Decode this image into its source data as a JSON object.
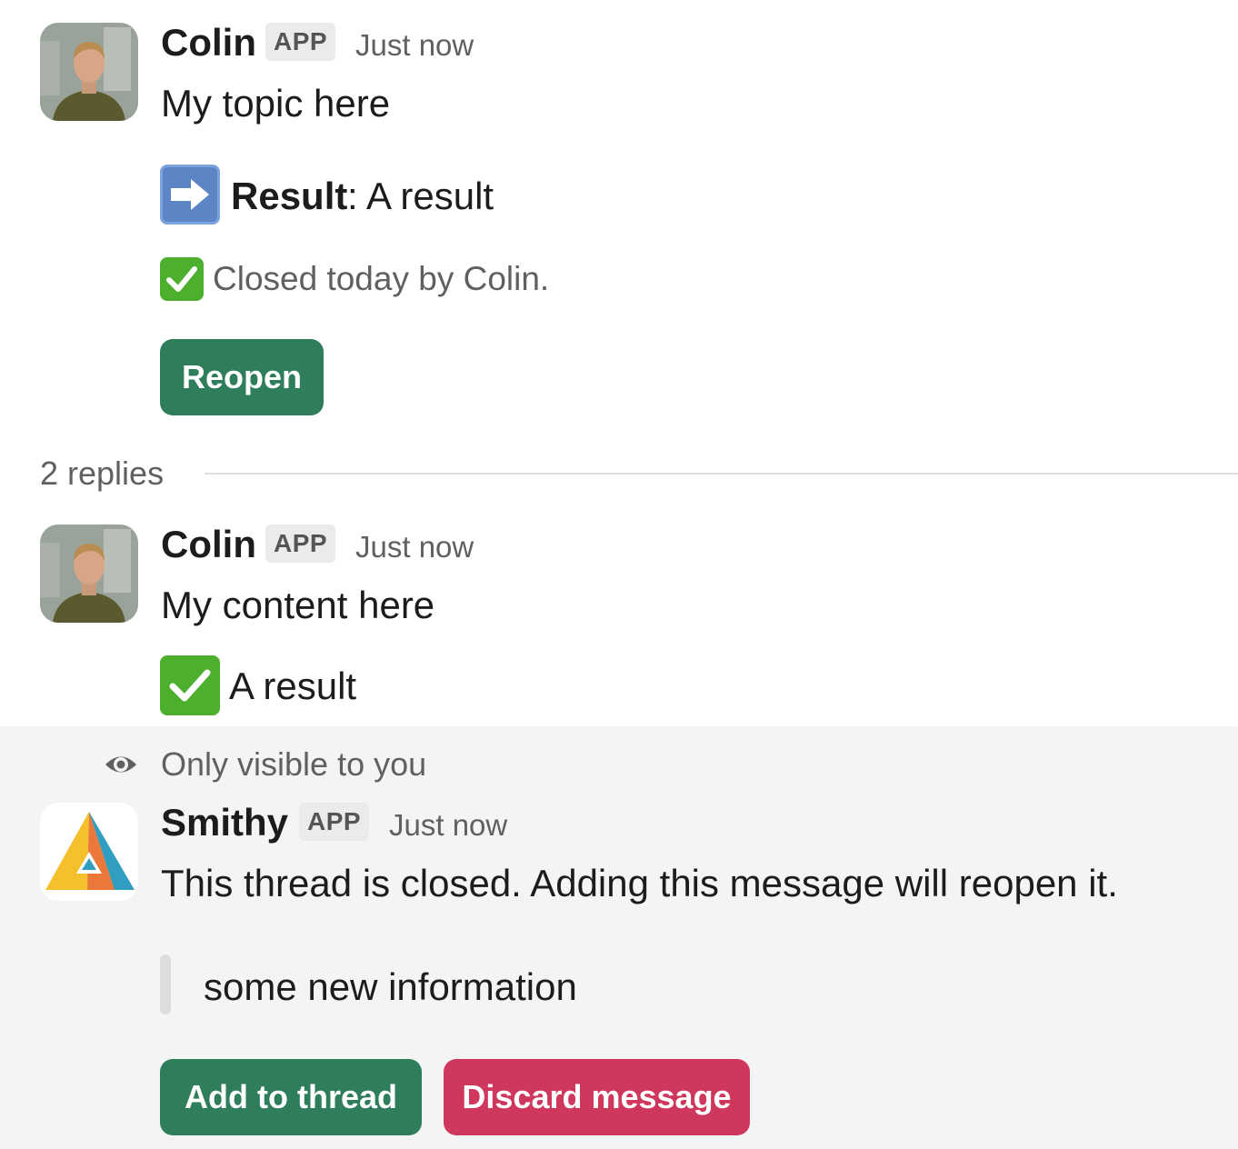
{
  "messages": [
    {
      "author": "Colin",
      "badge": "APP",
      "time": "Just now",
      "text": "My topic here",
      "result_label": "Result",
      "result_value": ": A result",
      "closed_text": "Closed today by Colin.",
      "button": "Reopen"
    },
    {
      "author": "Colin",
      "badge": "APP",
      "time": "Just now",
      "text": "My content here",
      "result_text": "A result"
    }
  ],
  "thread": {
    "replies_label": "2 replies"
  },
  "ephemeral": {
    "visibility_note": "Only visible to you",
    "author": "Smithy",
    "badge": "APP",
    "time": "Just now",
    "text": "This thread is closed. Adding this message will reopen it.",
    "quote": "some new information",
    "add_button": "Add to thread",
    "discard_button": "Discard message"
  },
  "icons": [
    "arrow-right-icon",
    "check-mark-icon",
    "eye-icon",
    "smithy-logo-icon",
    "user-avatar"
  ],
  "colors": {
    "primary_button": "#2e7d5b",
    "danger_button": "#d0375c",
    "ephemeral_bg": "#f4f4f4"
  }
}
